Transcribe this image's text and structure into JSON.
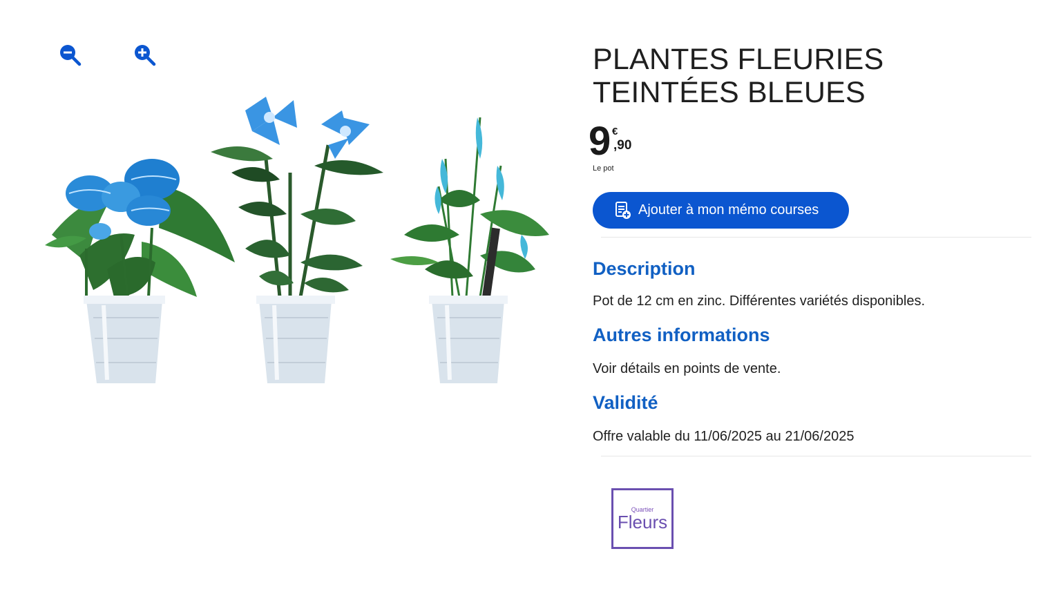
{
  "zoom": {
    "zoom_out_icon": "zoom-out-icon",
    "zoom_in_icon": "zoom-in-icon"
  },
  "product": {
    "title": "PLANTES FLEURIES TEINTÉES BLEUES",
    "price": {
      "integer": "9",
      "currency": "€",
      "cents": ",90",
      "unit": "Le pot"
    },
    "memo_button_label": "Ajouter à mon mémo courses",
    "memo_icon": "shopping-list-add-icon"
  },
  "sections": {
    "description": {
      "title": "Description",
      "text": "Pot de 12 cm en zinc. Différentes variétés disponibles."
    },
    "other_info": {
      "title": "Autres informations",
      "text": "Voir détails en points de vente."
    },
    "validity": {
      "title": "Validité",
      "text": "Offre valable du 11/06/2025 au 21/06/2025"
    }
  },
  "brand": {
    "small": "Quartier",
    "big": "Fleurs"
  },
  "colors": {
    "accent": "#0b56d0",
    "section_title": "#1160c3",
    "brand_border": "#6a4fb0"
  }
}
